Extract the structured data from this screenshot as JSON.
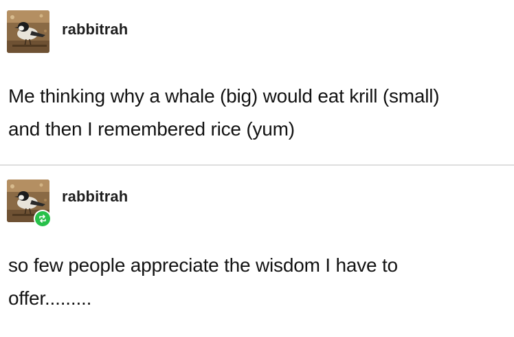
{
  "posts": [
    {
      "username": "rabbitrah",
      "text": "Me thinking why a whale (big) would eat krill (small)\nand then I remembered rice (yum)",
      "avatar_icon": "bird-avatar",
      "reblog": false
    },
    {
      "username": "rabbitrah",
      "text": "so few people appreciate the wisdom I have to\noffer.........",
      "avatar_icon": "bird-avatar",
      "reblog": true,
      "reblog_icon": "reblog-icon",
      "reblog_color": "#27c04a"
    }
  ]
}
